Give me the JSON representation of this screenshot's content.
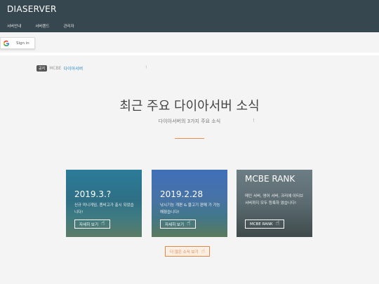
{
  "header": {
    "brand": "DIASERVER",
    "nav": [
      "서버안내",
      "서버랜드",
      "관리자"
    ]
  },
  "signin": {
    "label": "Sign in"
  },
  "notice": {
    "badge": "공지",
    "prefix": "MCBE",
    "link": "다이아서버",
    "mark": "!"
  },
  "section": {
    "title": "최근 주요 다이아서버 소식",
    "subtitle": "다이아서버의 3가지 주요 소식",
    "mark": "!"
  },
  "cards": [
    {
      "title": "2019.3.?",
      "desc": "신규 미니게임, 좀비고가 출시 되었습니다!",
      "button": "자세히 보기"
    },
    {
      "title": "2019.2.28",
      "desc": "낚시기능 개편 & 물고기 판매 가 가능해졌습니다!",
      "button": "자세히 보기"
    },
    {
      "title": "MCBE RANK",
      "desc": "메인 서버, 영어 서버, 크리에 이티브 서버까지 모두 등록하 였습니다!",
      "button": "MCBE RANK"
    }
  ],
  "more_button": "더 많은 소식 보기",
  "colors": {
    "topbar": "#37474f",
    "accent": "#ec8a4c",
    "link": "#2a8bd6"
  },
  "icons": {
    "hand": "hand-pointer-icon",
    "google": "google-icon"
  }
}
